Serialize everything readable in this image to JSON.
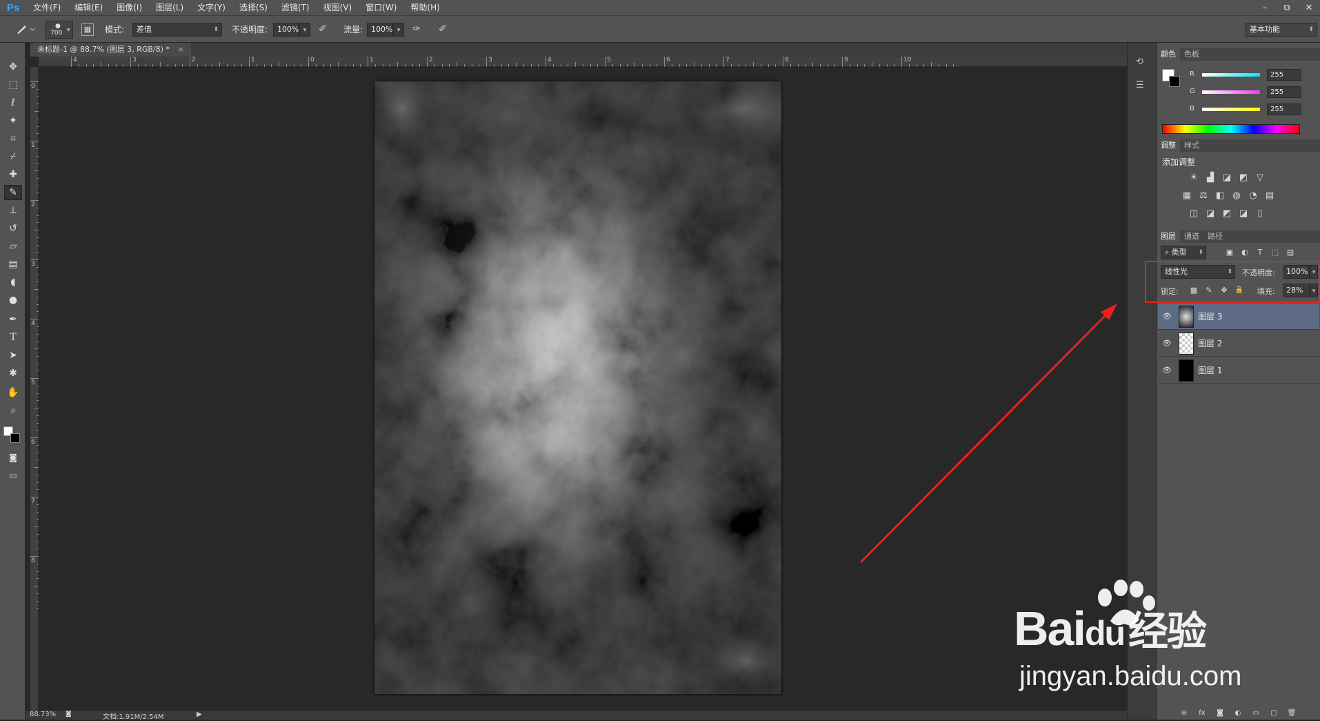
{
  "app": {
    "logo": "Ps"
  },
  "menubar": {
    "items": [
      "文件(F)",
      "编辑(E)",
      "图像(I)",
      "图层(L)",
      "文字(Y)",
      "选择(S)",
      "滤镜(T)",
      "视图(V)",
      "窗口(W)",
      "帮助(H)"
    ],
    "window_buttons": [
      "–",
      "⧉",
      "✕"
    ]
  },
  "options_bar": {
    "brush_size": "700",
    "mode_label": "模式:",
    "mode_value": "差值",
    "opacity_label": "不透明度:",
    "opacity_value": "100%",
    "flow_label": "流量:",
    "flow_value": "100%",
    "workspace": "基本功能"
  },
  "document": {
    "tab_title": "未标题-1 @ 88.7% (图层 3, RGB/8) *",
    "tab_close": "×",
    "ruler_h_labels": [
      "4",
      "3",
      "2",
      "1",
      "0",
      "1",
      "2",
      "3",
      "4",
      "5",
      "6",
      "7",
      "8",
      "9",
      "10"
    ],
    "ruler_v_labels": [
      "0",
      "1",
      "2",
      "3",
      "4",
      "5",
      "6",
      "7",
      "8"
    ]
  },
  "status": {
    "zoom": "88.73%",
    "doc_size": "文档:1.91M/2.54M",
    "arrow": "▶"
  },
  "color_panel": {
    "tabs": [
      "颜色",
      "色板"
    ],
    "channels": [
      {
        "label": "R",
        "value": "255",
        "color": "#00e5ff"
      },
      {
        "label": "G",
        "value": "255",
        "color": "#ff33ff"
      },
      {
        "label": "B",
        "value": "255",
        "color": "#ffff00"
      }
    ]
  },
  "adjust_panel": {
    "tabs": [
      "调整",
      "样式"
    ],
    "heading": "添加调整",
    "row1": [
      "☀",
      "▟",
      "◪",
      "◩",
      "▽"
    ],
    "row2": [
      "▦",
      "⚖",
      "◧",
      "◍",
      "◔",
      "▤"
    ],
    "row3": [
      "◫",
      "◪",
      "◩",
      "◪",
      "▯"
    ]
  },
  "layers_panel": {
    "tabs": [
      "图层",
      "通道",
      "路径"
    ],
    "filter_label": "类型",
    "filter_icons": [
      "▣",
      "◐",
      "T",
      "⬚",
      "▤"
    ],
    "blend_mode": "线性光",
    "opacity_label": "不透明度:",
    "opacity_value": "100%",
    "lock_label": "锁定:",
    "lock_icons": [
      "▩",
      "✎",
      "✥",
      "🔒"
    ],
    "fill_label": "填充:",
    "fill_value": "28%",
    "layers": [
      {
        "name": "图层 3",
        "selected": true
      },
      {
        "name": "图层 2",
        "selected": false
      },
      {
        "name": "图层 1",
        "selected": false
      }
    ],
    "footer_icons": [
      "⊖",
      "fx",
      "◙",
      "◐",
      "▭",
      "▢",
      "🗑"
    ]
  },
  "annotation": {
    "color": "#e8231c"
  },
  "watermark": {
    "brand_text": "Bai",
    "brand_text2": "du",
    "brand_cn": "经验",
    "url": "jingyan.baidu.com"
  }
}
